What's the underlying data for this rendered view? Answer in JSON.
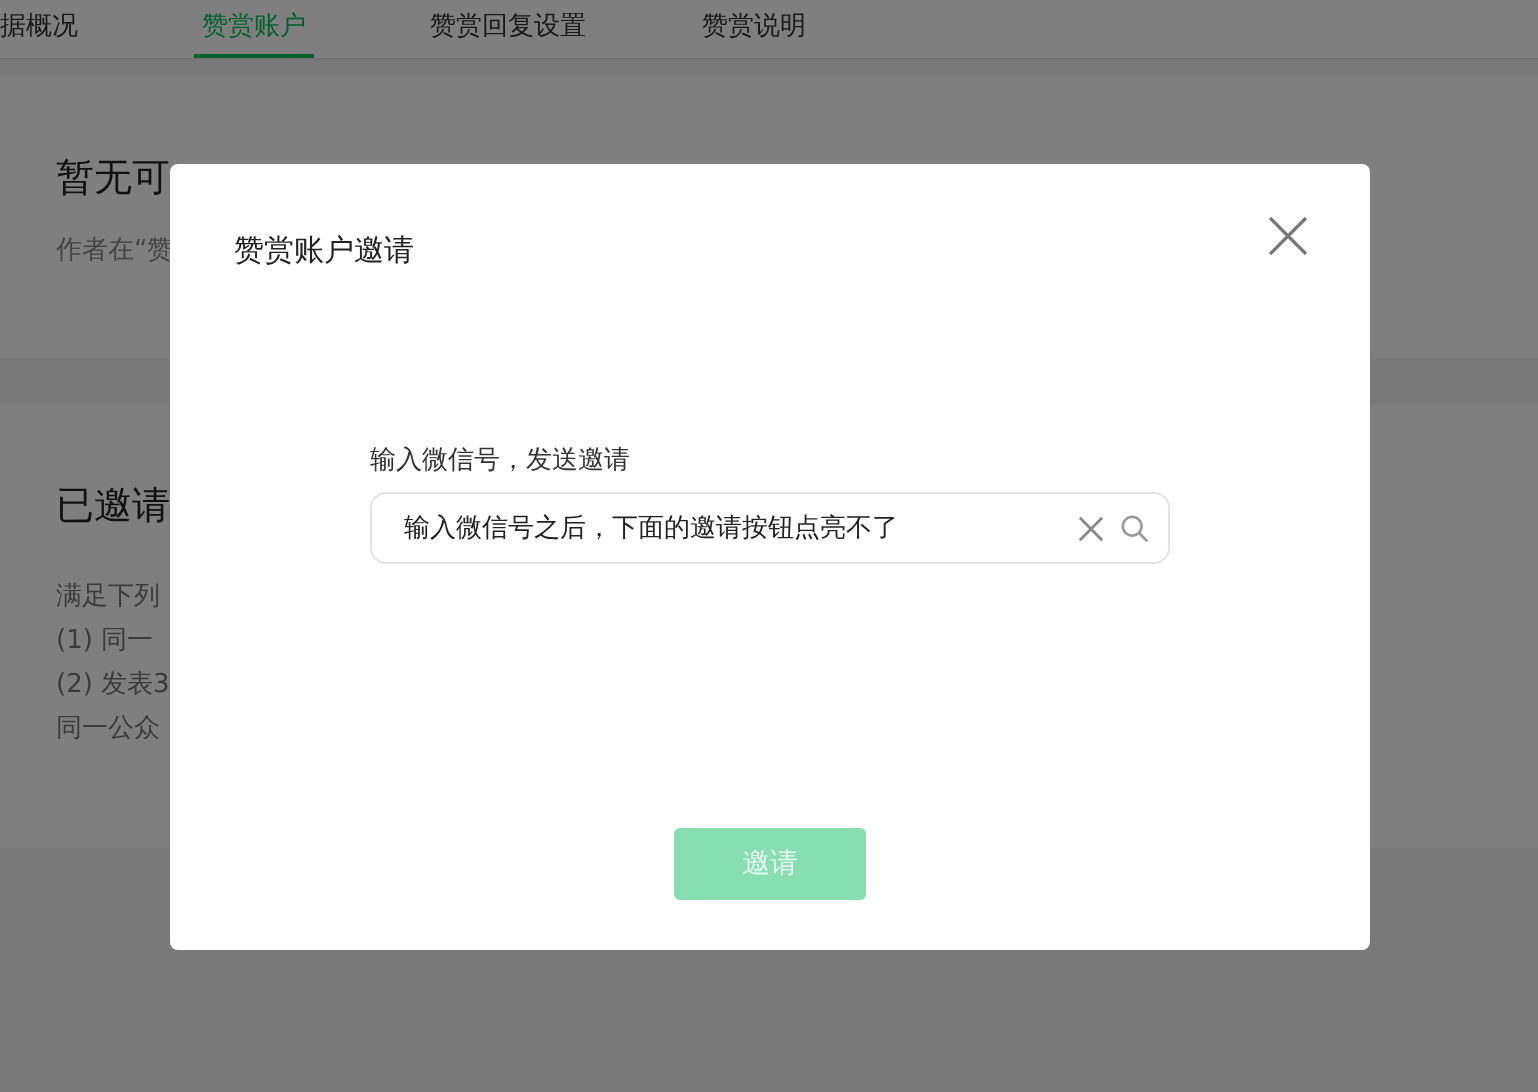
{
  "tabs": [
    {
      "label": "据概况",
      "selected": false
    },
    {
      "label": "赞赏账户",
      "selected": true
    },
    {
      "label": "赞赏回复设置",
      "selected": false
    },
    {
      "label": "赞赏说明",
      "selected": false
    }
  ],
  "section_1": {
    "title": "暂无可",
    "desc": "作者在“赞"
  },
  "section_2": {
    "title": "已邀请",
    "lines": [
      "满足下列",
      "(1) 同一",
      "(2) 发表3",
      "同一公众"
    ]
  },
  "dialog": {
    "title": "赞赏账户邀请",
    "label": "输入微信号，发送邀请",
    "input": {
      "value": "输入微信号之后，下面的邀请按钮点亮不了"
    },
    "invite_button": {
      "label": "邀请",
      "disabled": true
    }
  }
}
